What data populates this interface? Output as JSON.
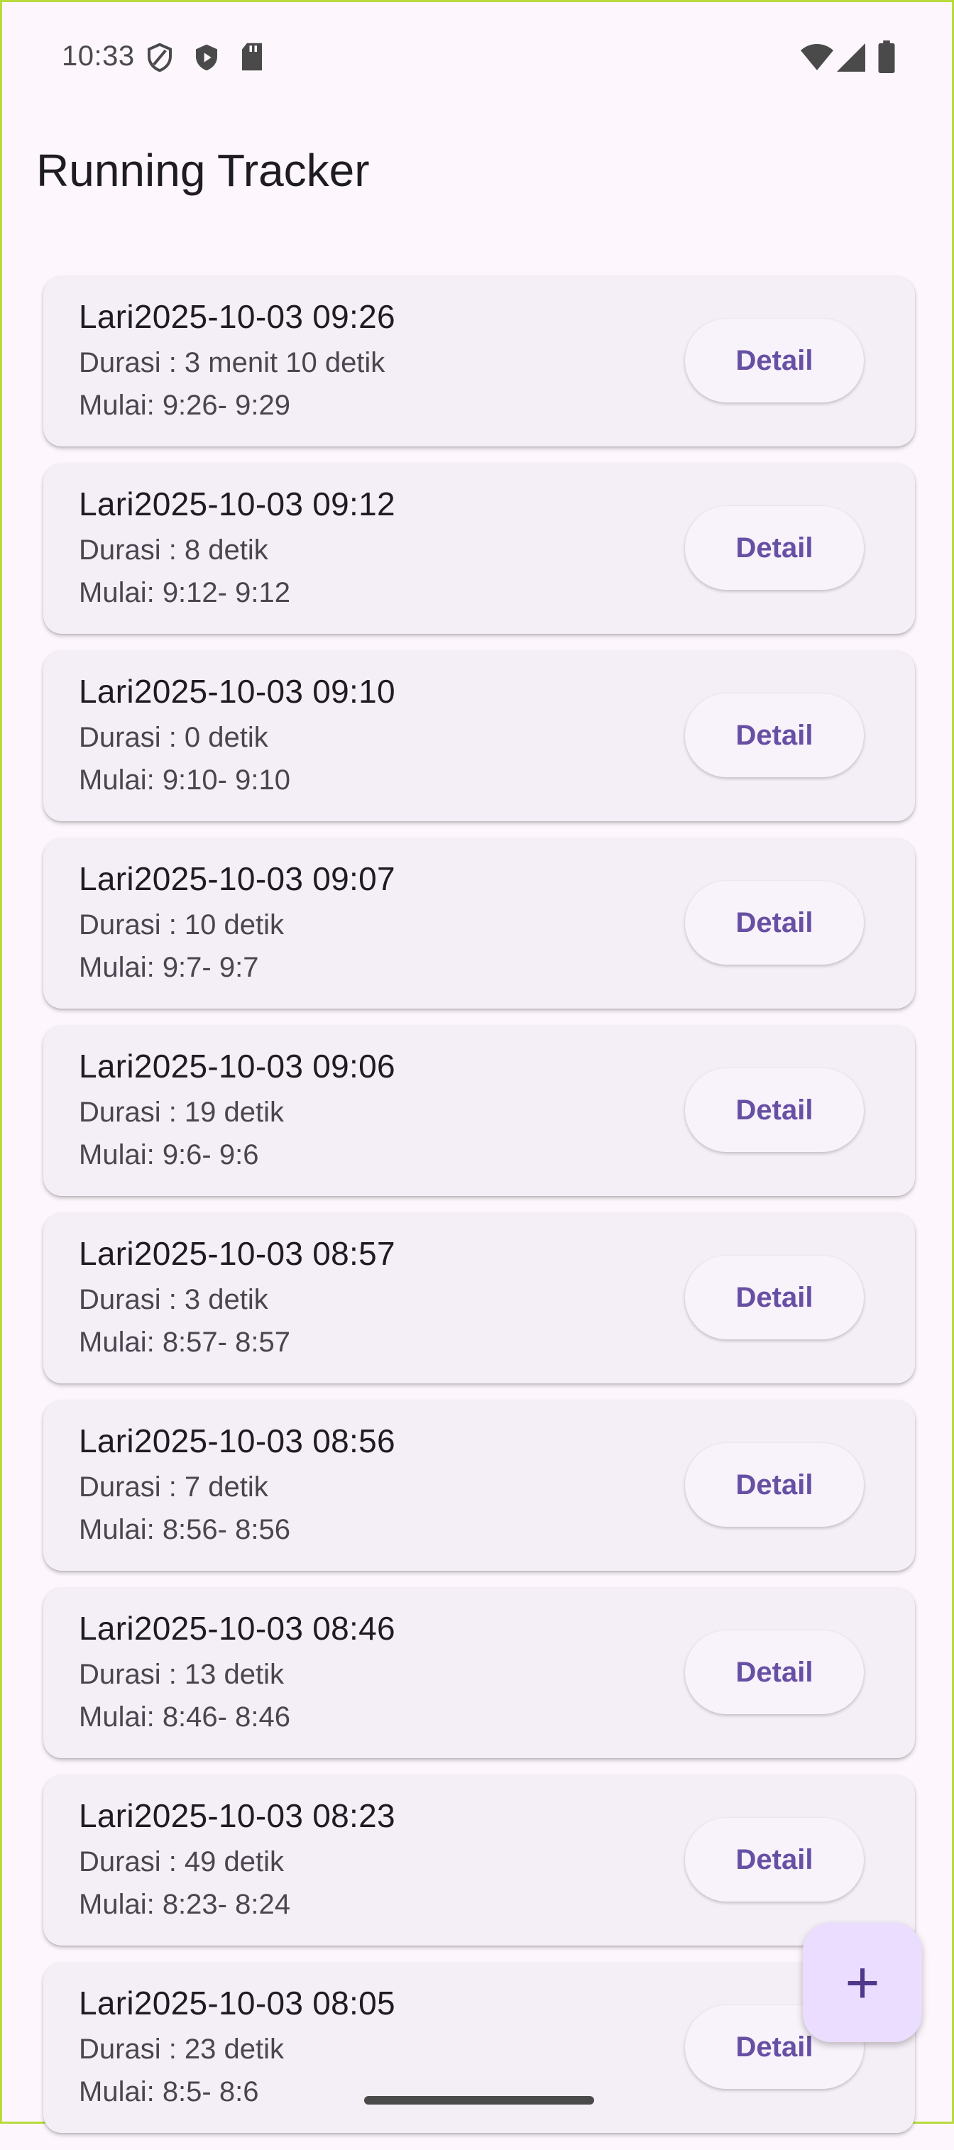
{
  "status_bar": {
    "time": "10:33",
    "icons": [
      "shield-icon",
      "play-protect-icon",
      "sd-card-icon",
      "wifi-icon",
      "signal-icon",
      "battery-icon"
    ]
  },
  "app": {
    "title": "Running Tracker"
  },
  "runs": [
    {
      "title": "Lari2025-10-03 09:26",
      "duration": "Durasi : 3 menit 10 detik",
      "time": "Mulai: 9:26- 9:29",
      "button": "Detail"
    },
    {
      "title": "Lari2025-10-03 09:12",
      "duration": "Durasi : 8 detik",
      "time": "Mulai: 9:12- 9:12",
      "button": "Detail"
    },
    {
      "title": "Lari2025-10-03 09:10",
      "duration": "Durasi : 0 detik",
      "time": "Mulai: 9:10- 9:10",
      "button": "Detail"
    },
    {
      "title": "Lari2025-10-03 09:07",
      "duration": "Durasi : 10 detik",
      "time": "Mulai: 9:7- 9:7",
      "button": "Detail"
    },
    {
      "title": "Lari2025-10-03 09:06",
      "duration": "Durasi : 19 detik",
      "time": "Mulai: 9:6- 9:6",
      "button": "Detail"
    },
    {
      "title": "Lari2025-10-03 08:57",
      "duration": "Durasi : 3 detik",
      "time": "Mulai: 8:57- 8:57",
      "button": "Detail"
    },
    {
      "title": "Lari2025-10-03 08:56",
      "duration": "Durasi : 7 detik",
      "time": "Mulai: 8:56- 8:56",
      "button": "Detail"
    },
    {
      "title": "Lari2025-10-03 08:46",
      "duration": "Durasi : 13 detik",
      "time": "Mulai: 8:46- 8:46",
      "button": "Detail"
    },
    {
      "title": "Lari2025-10-03 08:23",
      "duration": "Durasi : 49 detik",
      "time": "Mulai: 8:23- 8:24",
      "button": "Detail"
    },
    {
      "title": "Lari2025-10-03 08:05",
      "duration": "Durasi : 23 detik",
      "time": "Mulai: 8:5- 8:6",
      "button": "Detail"
    }
  ],
  "fab": {
    "icon": "plus-icon",
    "label": "+"
  },
  "colors": {
    "accent": "#6750A4",
    "background": "#FDF7FD",
    "card": "#F4EEF6",
    "fab": "#EADDFF"
  }
}
